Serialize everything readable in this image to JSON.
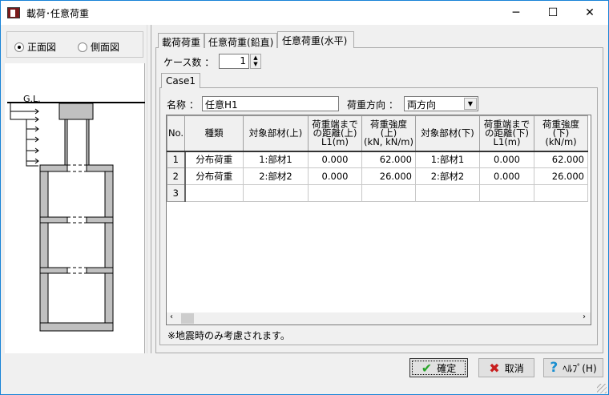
{
  "window": {
    "title": "載荷･任意荷重",
    "minimize": "─",
    "maximize": "☐",
    "close": "✕"
  },
  "view": {
    "options": [
      {
        "label": "正面図",
        "selected": true
      },
      {
        "label": "側面図",
        "selected": false
      }
    ]
  },
  "drawing": {
    "gl_label": "G.L."
  },
  "tabs": [
    {
      "label": "載荷荷重"
    },
    {
      "label": "任意荷重(鉛直)"
    },
    {
      "label": "任意荷重(水平)",
      "active": true
    }
  ],
  "case_count": {
    "label": "ケース数 ：",
    "value": "1"
  },
  "case_tabs": [
    {
      "label": "Case1"
    }
  ],
  "form": {
    "name_label": "名称 ：",
    "name_value": "任意H1",
    "direction_label": "荷重方向 ：",
    "direction_value": "両方向"
  },
  "table": {
    "headers": [
      "No.",
      "種類",
      "対象部材(上)",
      "荷重端までの距離(上)L1(m)",
      "荷重強度(上)(kN, kN/m)",
      "対象部材(下)",
      "荷重端までの距離(下)L1(m)",
      "荷重強度(下)(kN/m)"
    ],
    "header_lines": [
      [
        "No."
      ],
      [
        "種類"
      ],
      [
        "対象部材(上)"
      ],
      [
        "荷重端まで",
        "の距離(上)",
        "L1(m)"
      ],
      [
        "荷重強度",
        "(上)",
        "(kN, kN/m)"
      ],
      [
        "対象部材(下)"
      ],
      [
        "荷重端まで",
        "の距離(下)",
        "L1(m)"
      ],
      [
        "荷重強度",
        "(下)",
        "(kN/m)"
      ]
    ],
    "rows": [
      {
        "no": "1",
        "type": "分布荷重",
        "member_top": "1:部材1",
        "dist_top": "0.000",
        "intensity_top": "62.000",
        "member_bottom": "1:部材1",
        "dist_bottom": "0.000",
        "intensity_bottom": "62.000"
      },
      {
        "no": "2",
        "type": "分布荷重",
        "member_top": "2:部材2",
        "dist_top": "0.000",
        "intensity_top": "26.000",
        "member_bottom": "2:部材2",
        "dist_bottom": "0.000",
        "intensity_bottom": "26.000"
      },
      {
        "no": "3",
        "type": "",
        "member_top": "",
        "dist_top": "",
        "intensity_top": "",
        "member_bottom": "",
        "dist_bottom": "",
        "intensity_bottom": ""
      }
    ]
  },
  "note": "※地震時のみ考慮されます。",
  "buttons": {
    "ok": "確定",
    "cancel": "取消",
    "help": "ﾍﾙﾌﾟ(H)"
  },
  "colors": {
    "accent": "#1883d7",
    "ok_check": "#2aa52a",
    "cancel_x": "#c81e1e",
    "help_q": "#1a8fd0"
  }
}
